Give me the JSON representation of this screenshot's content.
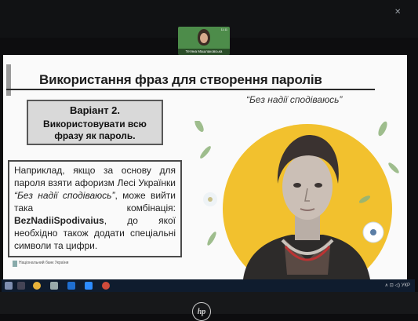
{
  "meeting": {
    "participant_name": "Тетяна Машлаковська",
    "participant_badge": "11:11"
  },
  "slide": {
    "title": "Використання фраз для створення паролів",
    "variant": {
      "heading": "Варіант 2.",
      "text": "Використовувати всю фразу як пароль."
    },
    "quote": "“Без надії сподіваюсь”",
    "example": {
      "part1": "Наприклад, якщо за основу для пароля взяти афоризм Лесі Українки ",
      "quote": "“Без надії сподіваюсь”",
      "part2": ", може вийти така комбінація: ",
      "combination": "BezNadiiSpodivaius",
      "part3": ", до якої необхідно також додати спеціальні символи та цифри."
    },
    "bank_logo": "Національний банк України"
  },
  "taskbar": {
    "icons": [
      "start-icon",
      "search-icon",
      "chrome-icon",
      "settings-icon",
      "outlook-icon",
      "zoom-icon",
      "paint-icon"
    ],
    "status_text": "∧ ⊡ ◁) УКР"
  },
  "colors": {
    "slide_bg": "#fafafa",
    "accent_yellow": "#f2c12e",
    "variant_bg": "#d9d9d9",
    "taskbar_bg": "#0f1c2e"
  }
}
